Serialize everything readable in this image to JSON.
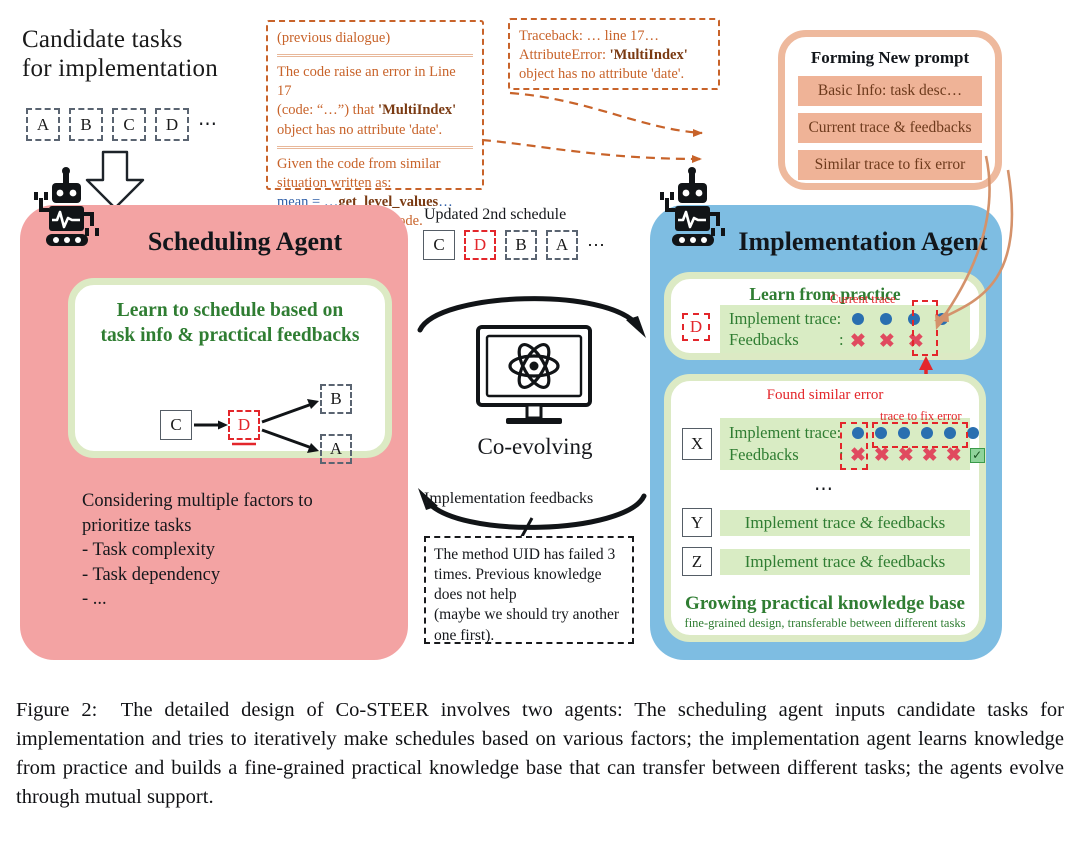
{
  "candidate": {
    "title_line1": "Candidate tasks",
    "title_line2": "for implementation",
    "tasks": [
      "A",
      "B",
      "C",
      "D"
    ],
    "ellipsis": "⋯",
    "arrow_icon": "down-arrow-icon"
  },
  "prev_dialogue_note": {
    "header": "(previous dialogue)",
    "line1": "The code raise an error in Line 17",
    "line2_a": "(code: “…”) that ",
    "line2_b": "'MultiIndex'",
    "line3": "object has no attribute 'date'.",
    "line4": "Given the code from similar",
    "line5": "situation written as:",
    "line6_a": "mean = …",
    "line6_b": "get_level_values",
    "line6_c": "…",
    "line7": "Please correct your code."
  },
  "traceback_note": {
    "line1": "Traceback: … line 17…",
    "line2_a": "AttributeError: ",
    "line2_b": "'MultiIndex'",
    "line3": "object has no attribute 'date'."
  },
  "forming_prompt": {
    "title": "Forming New prompt",
    "bars": [
      "Basic Info: task desc…",
      "Current trace & feedbacks",
      "Similar trace to fix error"
    ]
  },
  "scheduling_agent": {
    "title": "Scheduling Agent",
    "robot_icon": "robot-icon",
    "card_head_line1": "Learn to schedule based on",
    "card_head_line2": "task info & practical feedbacks",
    "graph": {
      "from": "C",
      "mid": "D",
      "to_top": "B",
      "to_bottom": "A"
    },
    "factors_intro_line1": "Considering multiple factors to",
    "factors_intro_line2": "prioritize tasks",
    "factors": [
      "- Task complexity",
      "- Task dependency",
      "- ..."
    ]
  },
  "center": {
    "schedule_label": "Updated 2nd schedule",
    "schedule_tasks": [
      "C",
      "D",
      "B",
      "A"
    ],
    "schedule_ellipsis": "⋯",
    "monitor_icon": "monitor-atom-icon",
    "coevolving_label": "Co-evolving",
    "feedback_label": "Implementation feedbacks",
    "feedback_note": {
      "line1": "The method UID has failed 3",
      "line2": "times. Previous knowledge",
      "line3": "does not help",
      "line4": "(maybe we should try another",
      "line5": "one first)."
    }
  },
  "implementation_agent": {
    "title": "Implementation Agent",
    "robot_icon": "robot-icon",
    "learn_card": {
      "heading": "Learn from practice",
      "task_chip": "D",
      "current_trace_label": "Current trace",
      "trace_row_label": "Implement trace:",
      "feedback_row_label": "Feedbacks",
      "feedback_colon": ":",
      "dots": 4,
      "feedbacks": [
        "x",
        "x",
        "x"
      ],
      "highlight_index": 3
    },
    "similar_card": {
      "heading": "Found similar error",
      "task_chip": "X",
      "fix_label": "trace to fix error",
      "trace_row_label": "Implement trace:",
      "feedback_row_label": "Feedbacks",
      "feedback_colon": ":",
      "dots": 6,
      "feedbacks": [
        "x",
        "x",
        "x",
        "x",
        "x",
        "ok"
      ],
      "ellipsis": "⋯",
      "rows": [
        {
          "chip": "Y",
          "label": "Implement trace & feedbacks"
        },
        {
          "chip": "Z",
          "label": "Implement trace & feedbacks"
        }
      ],
      "kb_title": "Growing practical knowledge base",
      "kb_sub": "fine-grained design, transferable between different tasks"
    }
  },
  "caption": {
    "label": "Figure 2:",
    "text": "The detailed design of Co-STEER involves two agents: The scheduling agent inputs candidate tasks for implementation and tries to iteratively make schedules based on various factors; the implementation agent learns knowledge from practice and builds a fine-grained practical knowledge base that can transfer between different tasks; the agents evolve through mutual support."
  },
  "colors": {
    "pink_panel": "#f3a3a3",
    "blue_panel": "#7ebde2",
    "green_band": "#d9ecc4",
    "green_border": "#dceac4",
    "green_text": "#2f7d32",
    "orange": "#c8632a",
    "orange_bar": "#efb397",
    "red": "#e3262b",
    "dot_blue": "#2a6fb0"
  }
}
